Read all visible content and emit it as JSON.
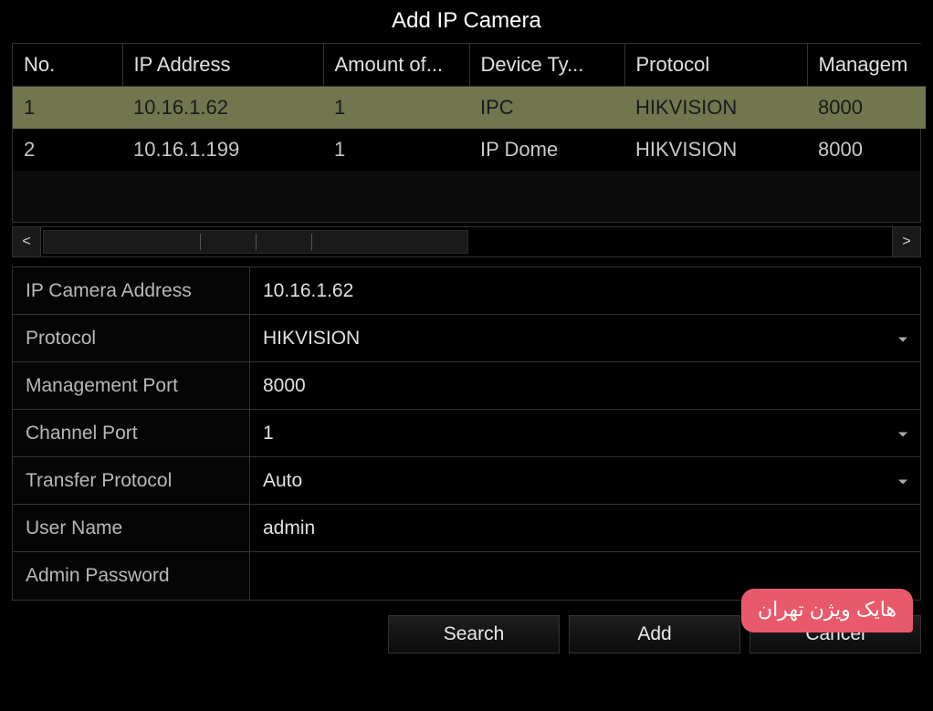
{
  "title": "Add IP Camera",
  "table": {
    "headers": [
      "No.",
      "IP Address",
      "Amount of...",
      "Device Ty...",
      "Protocol",
      "Managem"
    ],
    "col_widths": [
      "120",
      "220",
      "160",
      "170",
      "200",
      "130"
    ],
    "rows": [
      {
        "selected": true,
        "cells": [
          "1",
          "10.16.1.62",
          "1",
          "IPC",
          "HIKVISION",
          "8000"
        ]
      },
      {
        "selected": false,
        "cells": [
          "2",
          "10.16.1.199",
          "1",
          "IP Dome",
          "HIKVISION",
          "8000"
        ]
      }
    ]
  },
  "form": {
    "ip_camera_address": {
      "label": "IP Camera Address",
      "value": "10.16.1.62"
    },
    "protocol": {
      "label": "Protocol",
      "value": "HIKVISION",
      "dropdown": true
    },
    "management_port": {
      "label": "Management Port",
      "value": "8000"
    },
    "channel_port": {
      "label": "Channel Port",
      "value": "1",
      "dropdown": true
    },
    "transfer_protocol": {
      "label": "Transfer Protocol",
      "value": "Auto",
      "dropdown": true
    },
    "user_name": {
      "label": "User Name",
      "value": "admin"
    },
    "admin_password": {
      "label": "Admin Password",
      "value": ""
    }
  },
  "buttons": {
    "search": "Search",
    "add": "Add",
    "cancel": "Cancel"
  },
  "scroll": {
    "left_glyph": "<",
    "right_glyph": ">"
  },
  "watermark": "هایک ویژن تهران"
}
